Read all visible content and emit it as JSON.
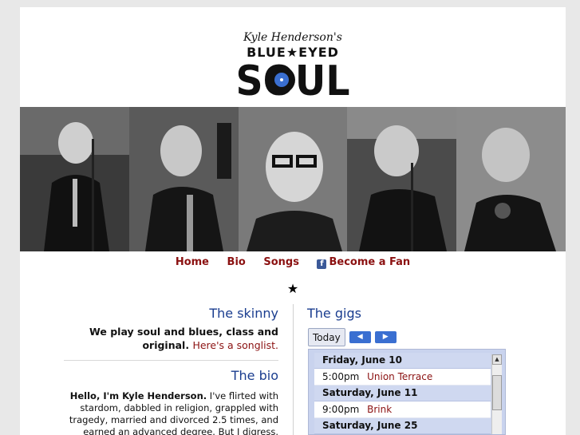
{
  "logo": {
    "top_line": "Kyle Henderson's",
    "middle_line": "BLUE★EYED",
    "main_word": "SOUL"
  },
  "nav": {
    "home": "Home",
    "bio": "Bio",
    "songs": "Songs",
    "fan": "Become a Fan",
    "fan_icon": "facebook-icon"
  },
  "star": "★",
  "skinny": {
    "title": "The skinny",
    "text": "We play soul and blues, class and original.",
    "link": "Here's a songlist."
  },
  "bio": {
    "title": "The bio",
    "lead": "Hello, I'm Kyle Henderson.",
    "text": "I've flirted with stardom, dabbled in religion, grappled with tragedy, married and divorced 2.5 times, and earned an advanced degree. But I digress."
  },
  "gigs": {
    "title": "The gigs",
    "today_label": "Today",
    "prev_icon": "arrow-left-icon",
    "next_icon": "arrow-right-icon",
    "days": [
      {
        "label": "Friday, June 10",
        "events": [
          {
            "time": "5:00pm",
            "title": "Union Terrace"
          }
        ]
      },
      {
        "label": "Saturday, June 11",
        "events": [
          {
            "time": "9:00pm",
            "title": "Brink"
          }
        ]
      },
      {
        "label": "Saturday, June 25",
        "events": []
      }
    ]
  },
  "colors": {
    "link": "#8b1111",
    "heading": "#1a3d8f",
    "calendar_bg": "#c9d3ee",
    "nav_button": "#3a6fd1"
  }
}
